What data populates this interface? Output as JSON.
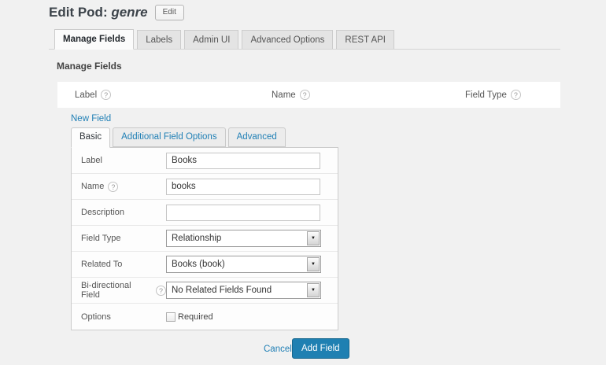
{
  "colors": {
    "page_bg": "#f1f1f1",
    "accent_blue": "#1f80b2",
    "link_blue": "#1f7fb5"
  },
  "icons": {
    "help": "?",
    "dropdown_arrow": "▼"
  },
  "header": {
    "title_prefix": "Edit Pod:",
    "pod_name": "genre",
    "edit_button_label": "Edit"
  },
  "tabs": [
    {
      "label": "Manage Fields",
      "active": true
    },
    {
      "label": "Labels",
      "active": false
    },
    {
      "label": "Admin UI",
      "active": false
    },
    {
      "label": "Advanced Options",
      "active": false
    },
    {
      "label": "REST API",
      "active": false
    }
  ],
  "section_heading": "Manage Fields",
  "field_table": {
    "columns": [
      {
        "label": "Label"
      },
      {
        "label": "Name"
      },
      {
        "label": "Field Type"
      }
    ]
  },
  "new_field_link_label": "New Field",
  "field_editor": {
    "subtabs": [
      {
        "label": "Basic",
        "active": true
      },
      {
        "label": "Additional Field Options",
        "active": false
      },
      {
        "label": "Advanced",
        "active": false
      }
    ],
    "rows": [
      {
        "label": "Label",
        "control": "text",
        "value": "Books"
      },
      {
        "label": "Name",
        "help": true,
        "control": "text",
        "value": "books"
      },
      {
        "label": "Description",
        "control": "text",
        "value": ""
      },
      {
        "label": "Field Type",
        "control": "select",
        "value": "Relationship"
      },
      {
        "label": "Related To",
        "control": "select",
        "value": "Books (book)"
      },
      {
        "label": "Bi-directional Field",
        "help": true,
        "control": "select",
        "value": "No Related Fields Found"
      },
      {
        "label": "Options",
        "control": "checkbox",
        "checkbox_label": "Required",
        "checked": false
      }
    ],
    "footer": {
      "cancel_label": "Cancel",
      "submit_label": "Add Field"
    }
  }
}
